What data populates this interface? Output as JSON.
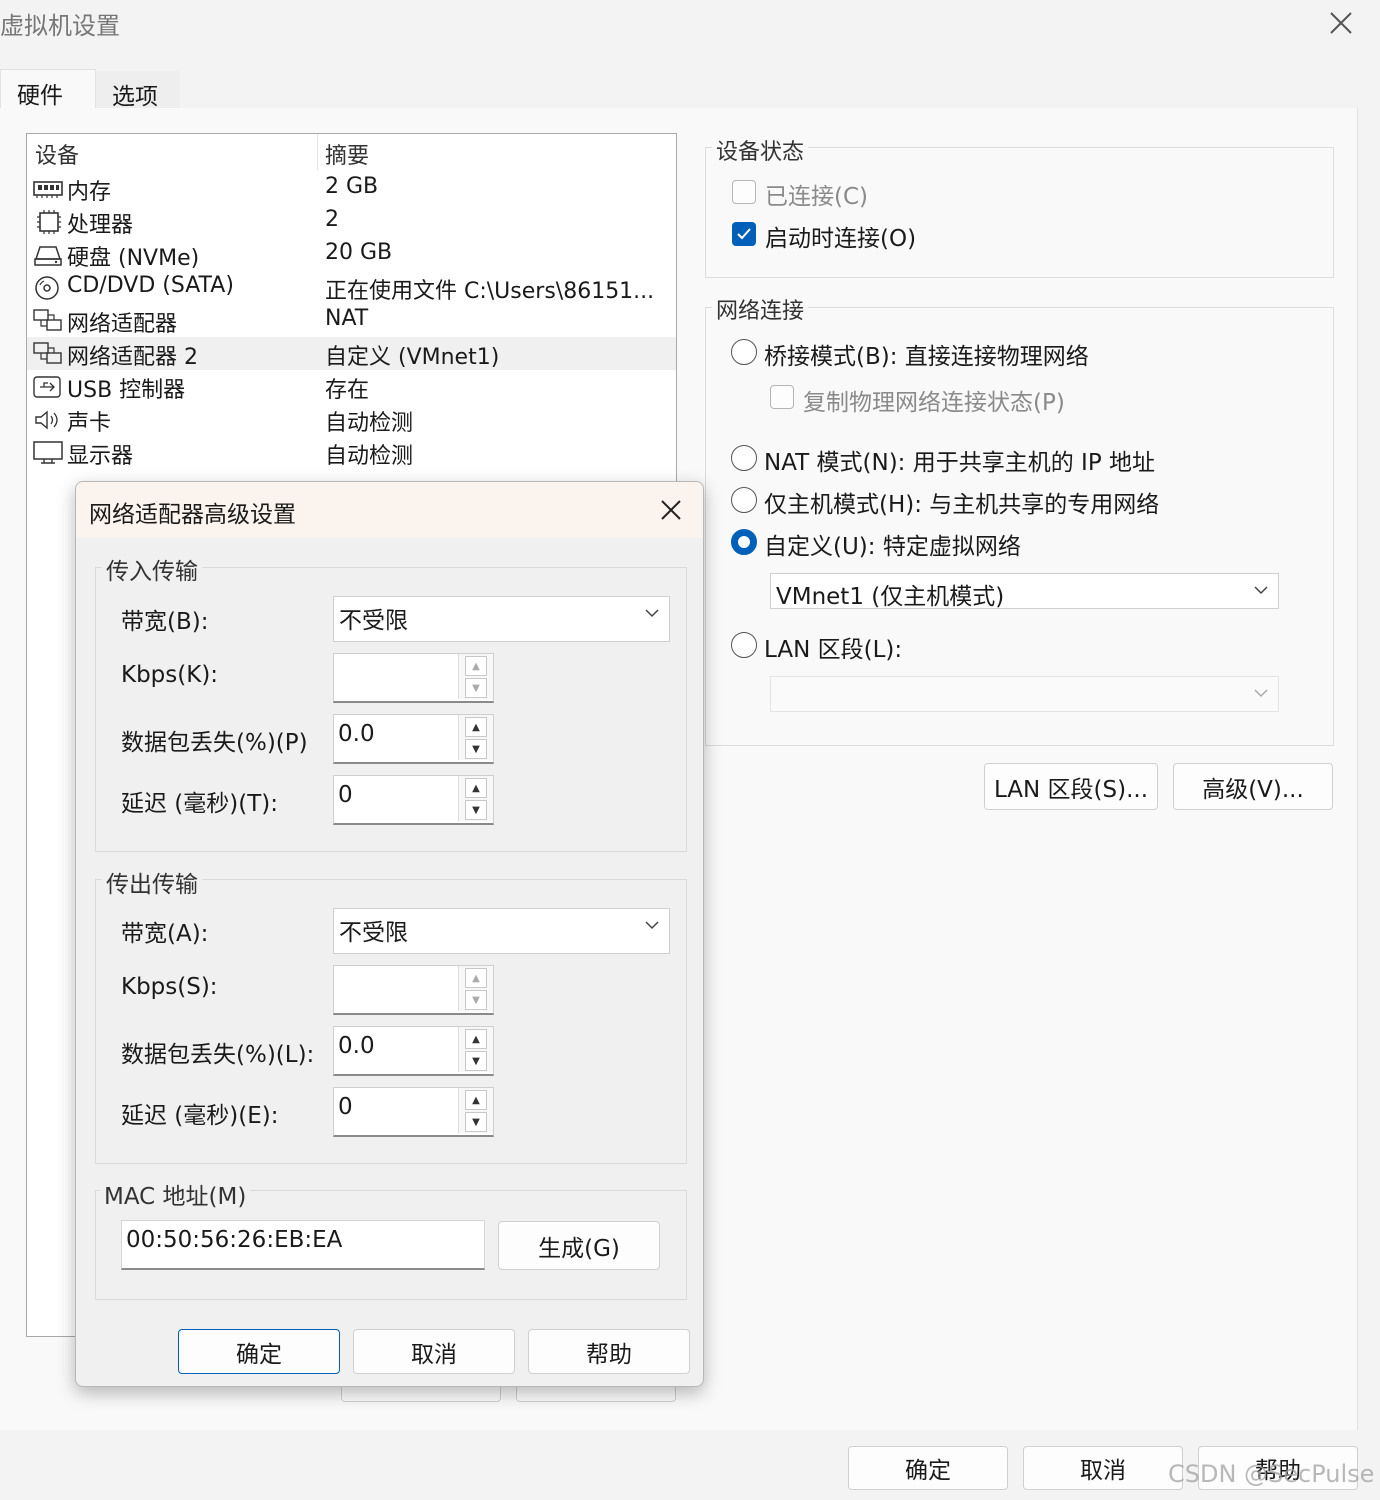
{
  "window": {
    "title": "虚拟机设置"
  },
  "tabs": [
    {
      "label": "硬件"
    },
    {
      "label": "选项"
    }
  ],
  "device_list": {
    "headers": {
      "device": "设备",
      "summary": "摘要"
    },
    "rows": [
      {
        "name": "内存",
        "summary": "2 GB",
        "icon": "memory-icon"
      },
      {
        "name": "处理器",
        "summary": "2",
        "icon": "cpu-icon"
      },
      {
        "name": "硬盘 (NVMe)",
        "summary": "20 GB",
        "icon": "disk-icon"
      },
      {
        "name": "CD/DVD (SATA)",
        "summary": "正在使用文件 C:\\Users\\86151...",
        "icon": "cd-icon"
      },
      {
        "name": "网络适配器",
        "summary": "NAT",
        "icon": "network-icon"
      },
      {
        "name": "网络适配器 2",
        "summary": "自定义 (VMnet1)",
        "icon": "network-icon",
        "selected": true
      },
      {
        "name": "USB 控制器",
        "summary": "存在",
        "icon": "usb-icon"
      },
      {
        "name": "声卡",
        "summary": "自动检测",
        "icon": "speaker-icon"
      },
      {
        "name": "显示器",
        "summary": "自动检测",
        "icon": "monitor-icon"
      }
    ]
  },
  "device_status": {
    "label": "设备状态",
    "connected": {
      "label": "已连接(C)",
      "checked": false,
      "enabled": false
    },
    "connect_at_power_on": {
      "label": "启动时连接(O)",
      "checked": true
    }
  },
  "network_connection": {
    "label": "网络连接",
    "bridged": {
      "label": "桥接模式(B): 直接连接物理网络",
      "selected": false
    },
    "replicate": {
      "label": "复制物理网络连接状态(P)",
      "checked": false,
      "enabled": false
    },
    "nat": {
      "label": "NAT 模式(N): 用于共享主机的 IP 地址",
      "selected": false
    },
    "host_only": {
      "label": "仅主机模式(H): 与主机共享的专用网络",
      "selected": false
    },
    "custom": {
      "label": "自定义(U): 特定虚拟网络",
      "selected": true,
      "value": "VMnet1 (仅主机模式)"
    },
    "lan_segment": {
      "label": "LAN 区段(L):",
      "selected": false,
      "value": ""
    }
  },
  "buttons": {
    "lan_segments": "LAN 区段(S)...",
    "advanced": "高级(V)...",
    "ok": "确定",
    "cancel": "取消",
    "help": "帮助"
  },
  "dialog": {
    "title": "网络适配器高级设置",
    "incoming": {
      "label": "传入传输",
      "bandwidth_label": "带宽(B):",
      "bandwidth": "不受限",
      "kbps_label": "Kbps(K):",
      "kbps": "",
      "loss_label": "数据包丢失(%)(P)",
      "loss": "0.0",
      "latency_label": "延迟 (毫秒)(T):",
      "latency": "0"
    },
    "outgoing": {
      "label": "传出传输",
      "bandwidth_label": "带宽(A):",
      "bandwidth": "不受限",
      "kbps_label": "Kbps(S):",
      "kbps": "",
      "loss_label": "数据包丢失(%)(L):",
      "loss": "0.0",
      "latency_label": "延迟 (毫秒)(E):",
      "latency": "0"
    },
    "mac": {
      "label": "MAC 地址(M)",
      "value": "00:50:56:26:EB:EA",
      "generate": "生成(G)"
    },
    "buttons": {
      "ok": "确定",
      "cancel": "取消",
      "help": "帮助"
    }
  },
  "watermark": "CSDN @SecPulse",
  "colors": {
    "accent": "#005fb8",
    "panel": "#f9f9f9",
    "window": "#f3f3f3"
  }
}
